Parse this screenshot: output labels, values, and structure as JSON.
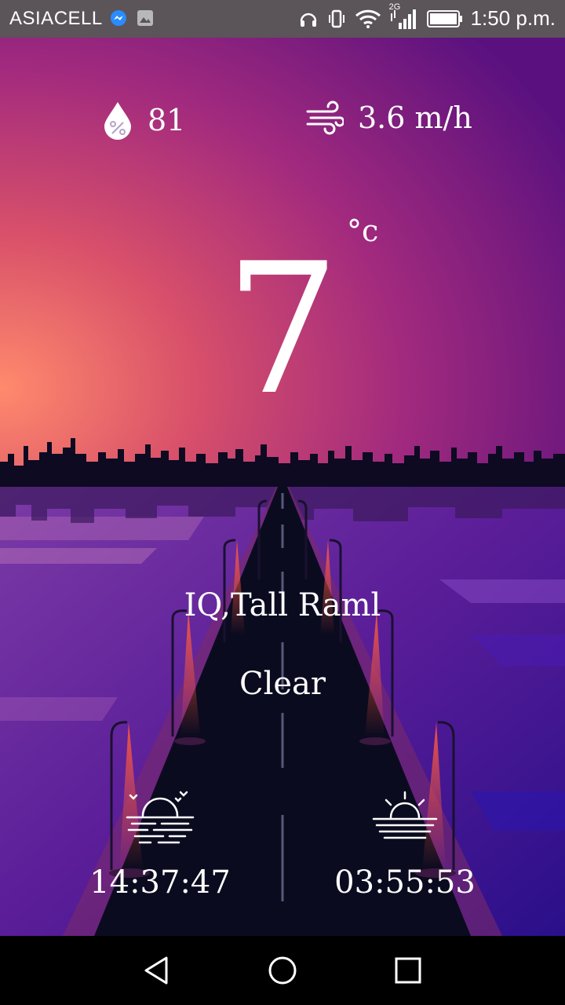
{
  "status_bar": {
    "carrier": "ASIACELL",
    "network": "2G",
    "time": "1:50 p.m."
  },
  "weather": {
    "humidity": "81",
    "wind": "3.6 m/h",
    "temperature": "7",
    "unit": "°c",
    "location": "IQ,Tall Raml",
    "condition": "Clear",
    "sunset_time": "14:37:47",
    "sunrise_time": "03:55:53"
  },
  "icons": {
    "humidity": "water-drop-percent-icon",
    "wind": "wind-icon",
    "sunset": "sunset-icon",
    "sunrise": "sunrise-icon"
  },
  "colors": {
    "sky_top": "#6a1a8a",
    "sky_glow": "#ff7b66",
    "skyline": "#0d0a22",
    "water": "#5b1e9e",
    "road": "#0b0b20"
  }
}
